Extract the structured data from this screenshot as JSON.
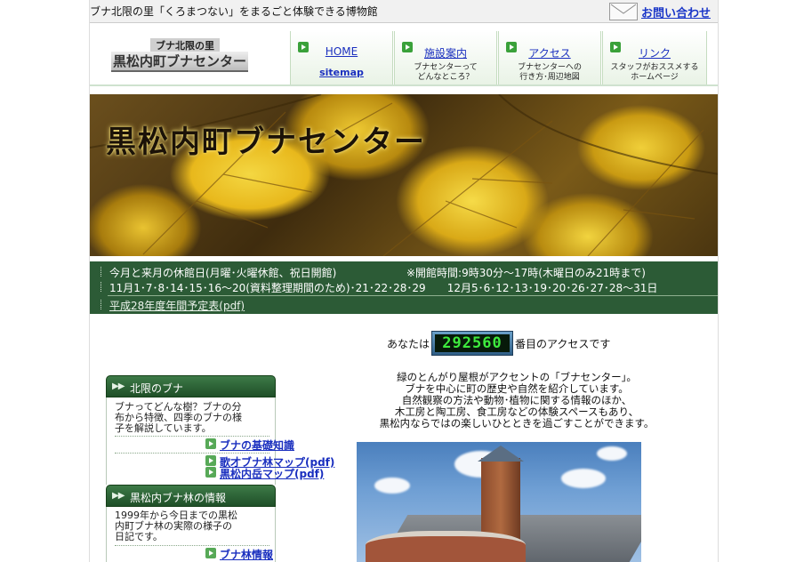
{
  "header": {
    "tagline": "ブナ北限の里「くろまつない」をまるごと体験できる博物館",
    "contact_label": "お問い合わせ"
  },
  "logo": {
    "sub": "ブナ北限の里",
    "main": "黒松内町ブナセンター"
  },
  "nav": [
    {
      "label": "HOME",
      "sub_link": "sitemap",
      "desc": []
    },
    {
      "label": "施設案内",
      "desc": [
        "ブナセンターって",
        "どんなところ？"
      ]
    },
    {
      "label": "アクセス",
      "desc": [
        "ブナセンターへの",
        "行き方･周辺地図"
      ]
    },
    {
      "label": "リンク",
      "desc": [
        "スタッフがおススメする",
        "ホームページ"
      ]
    }
  ],
  "banner": {
    "title": "黒松内町ブナセンター"
  },
  "info": {
    "closed_heading": "今月と来月の休館日(月曜･火曜休館、祝日開館)",
    "hours": "※開館時間:9時30分～17時(木曜日のみ21時まで)",
    "closed_dates": "11月1･7･8･14･15･16～20(資料整理期間のため)･21･22･28･29　　12月5･6･12･13･19･20･26･27･28～31日",
    "schedule_link": "平成28年度年間予定表(pdf)"
  },
  "sidebar": [
    {
      "title": "北限のブナ",
      "desc": [
        "ブナってどんな樹？ブナの分",
        "布から特徴、四季のブナの様",
        "子を解説しています。"
      ],
      "links": [
        "ブナの基礎知識",
        "歌才ブナ林マップ(pdf)",
        "黒松内岳マップ(pdf)"
      ]
    },
    {
      "title": "黒松内ブナ林の情報",
      "desc": [
        "1999年から今日までの黒松",
        "内町ブナ林の実際の様子の",
        "日記です。"
      ],
      "links": [
        "ブナ林情報"
      ]
    }
  ],
  "counter": {
    "prefix": "あなたは",
    "value": "292560",
    "suffix": "番目のアクセスです"
  },
  "intro": [
    "緑のとんがり屋根がアクセントの「ブナセンター」。",
    "ブナを中心に町の歴史や自然を紹介しています。",
    "自然観察の方法や動物･植物に関する情報のほか、",
    "木工房と陶工房、食工房などの体験スペースもあり、",
    "黒松内ならではの楽しいひとときを過ごすことができます。"
  ]
}
